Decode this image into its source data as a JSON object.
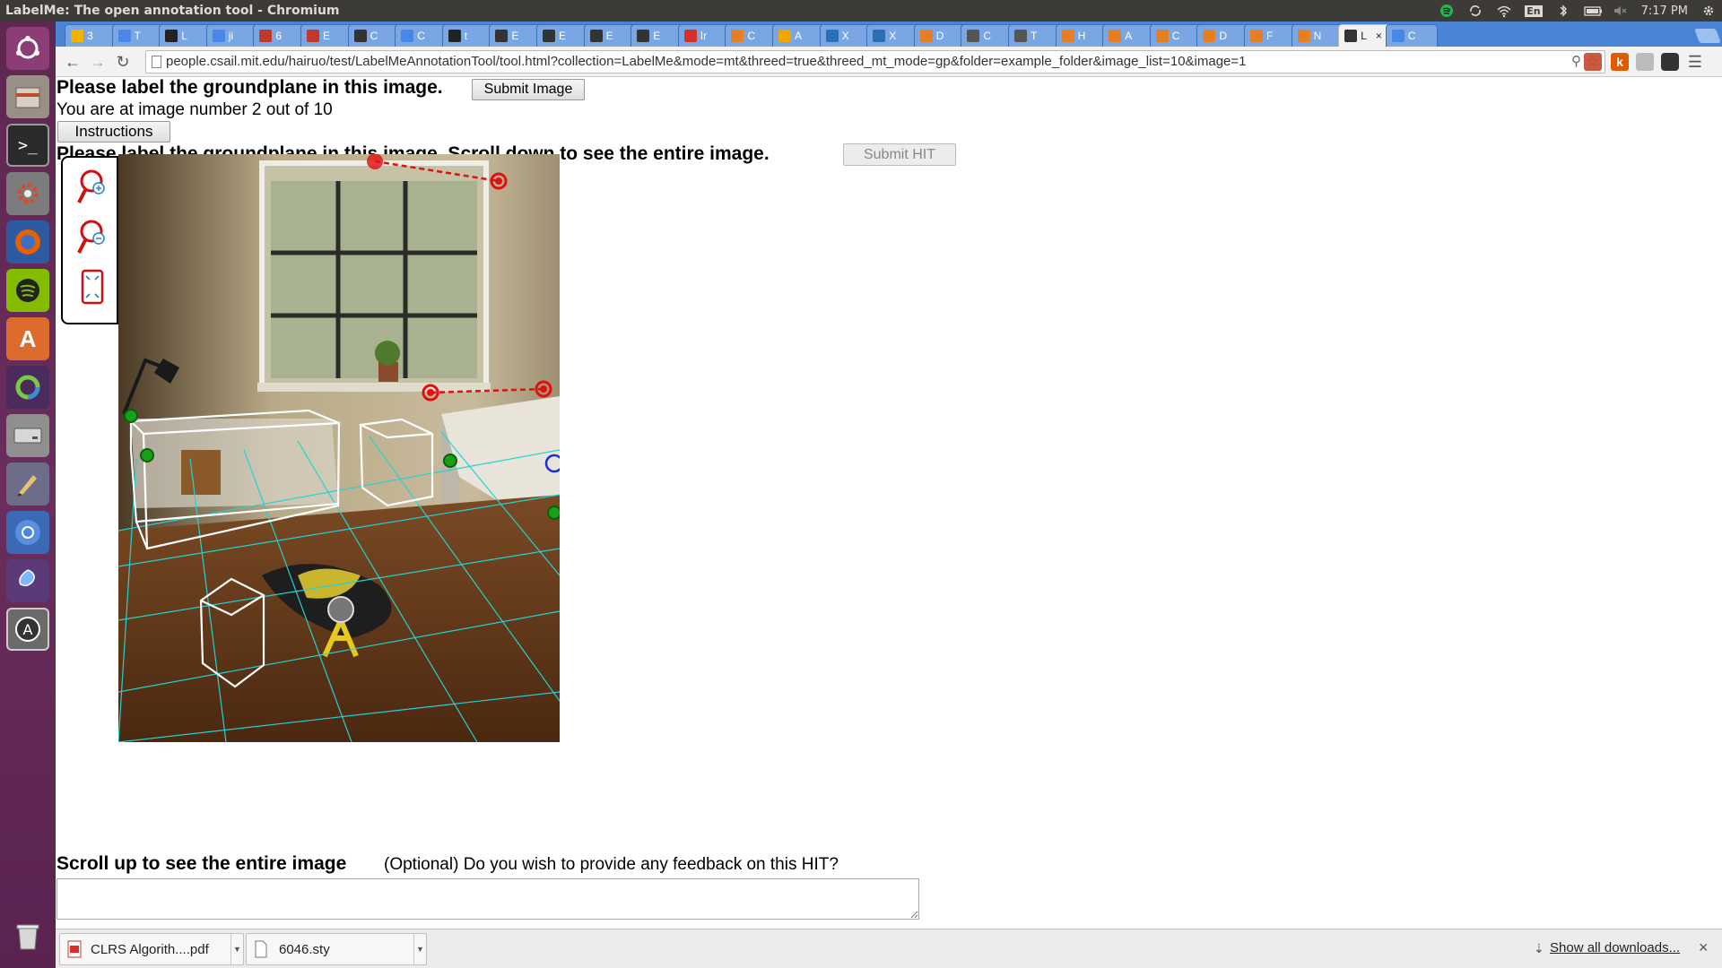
{
  "window": {
    "title": "LabelMe: The open annotation tool - Chromium"
  },
  "tray": {
    "time": "7:17 PM",
    "lang": "En"
  },
  "tabs": [
    {
      "label": "3",
      "color": "#f0b400"
    },
    {
      "label": "T",
      "color": "#4a86e8"
    },
    {
      "label": "L",
      "color": "#222222"
    },
    {
      "label": "ji",
      "color": "#4a86e8"
    },
    {
      "label": "6",
      "color": "#c0392b"
    },
    {
      "label": "E",
      "color": "#c0392b"
    },
    {
      "label": "C",
      "color": "#333333"
    },
    {
      "label": "C",
      "color": "#4a86e8"
    },
    {
      "label": "t",
      "color": "#222222"
    },
    {
      "label": "E",
      "color": "#333333"
    },
    {
      "label": "E",
      "color": "#333333"
    },
    {
      "label": "E",
      "color": "#333333"
    },
    {
      "label": "E",
      "color": "#333333"
    },
    {
      "label": "Ir",
      "color": "#d93025"
    },
    {
      "label": "C",
      "color": "#e67e22"
    },
    {
      "label": "A",
      "color": "#f0a500"
    },
    {
      "label": "X",
      "color": "#2c6fb5"
    },
    {
      "label": "X",
      "color": "#2c6fb5"
    },
    {
      "label": "D",
      "color": "#e67e22"
    },
    {
      "label": "C",
      "color": "#555555"
    },
    {
      "label": "T",
      "color": "#555555"
    },
    {
      "label": "H",
      "color": "#e67e22"
    },
    {
      "label": "A",
      "color": "#e67e22"
    },
    {
      "label": "C",
      "color": "#e67e22"
    },
    {
      "label": "D",
      "color": "#e67e22"
    },
    {
      "label": "F",
      "color": "#e67e22"
    },
    {
      "label": "N",
      "color": "#e67e22"
    },
    {
      "label": "L",
      "color": "#333333"
    },
    {
      "label": "C",
      "color": "#4a86e8"
    }
  ],
  "toolbar": {
    "url": "people.csail.mit.edu/hairuo/test/LabelMeAnnotationTool/tool.html?collection=LabelMe&mode=mt&threed=true&threed_mt_mode=gp&folder=example_folder&image_list=10&image=1"
  },
  "page": {
    "heading": "Please label the groundplane in this image.",
    "submit_image": "Submit Image",
    "progress": "You are at image number 2 out of 10",
    "instructions": "Instructions",
    "heading2": "Please label the groundplane in this image. Scroll down to see the entire image.",
    "submit_hit": "Submit HIT",
    "scroll_up": "Scroll up to see the entire image",
    "feedback_prompt": "(Optional) Do you wish to provide any feedback on this HIT?"
  },
  "downloads": {
    "items": [
      {
        "name": "CLRS Algorith....pdf",
        "icon": "pdf-icon"
      },
      {
        "name": "6046.sty",
        "icon": "file-icon"
      }
    ],
    "show_all": "Show all downloads..."
  },
  "colors": {
    "launcher": "#5e2750",
    "tabstrip": "#4a84d4",
    "grid": "#22d3d3",
    "control_point": "#e01010",
    "ground_point": "#18a018"
  }
}
